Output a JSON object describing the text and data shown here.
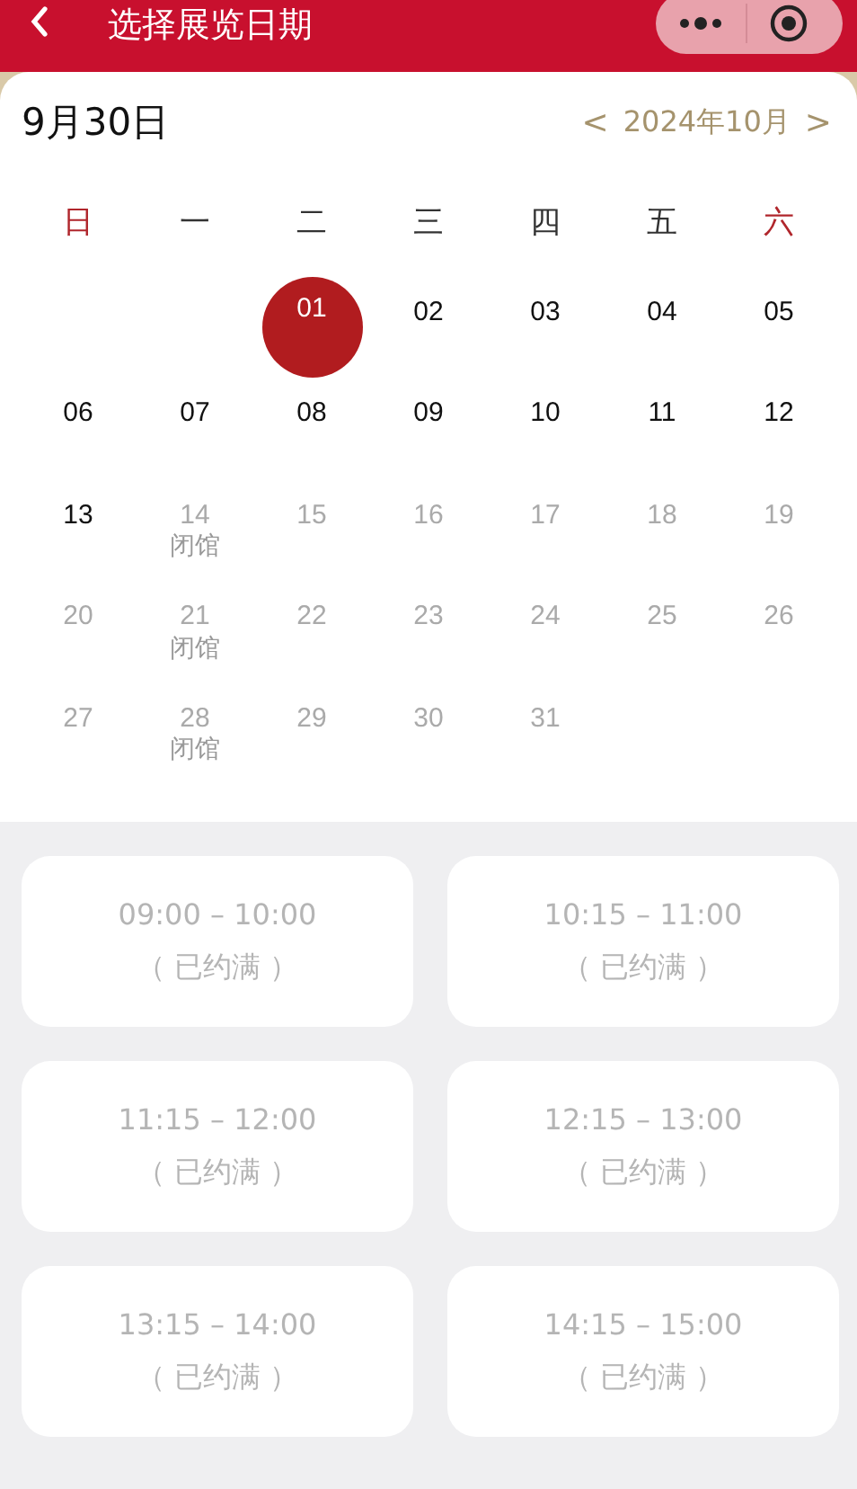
{
  "header": {
    "title": "选择展览日期"
  },
  "calendar": {
    "selected_date": "9月30日",
    "prev": "<",
    "month": "2024年10月",
    "next": ">",
    "weekdays": [
      {
        "label": "日",
        "weekend": true
      },
      {
        "label": "一",
        "weekend": false
      },
      {
        "label": "二",
        "weekend": false
      },
      {
        "label": "三",
        "weekend": false
      },
      {
        "label": "四",
        "weekend": false
      },
      {
        "label": "五",
        "weekend": false
      },
      {
        "label": "六",
        "weekend": true
      }
    ],
    "days": [
      {
        "kind": "blank"
      },
      {
        "kind": "blank"
      },
      {
        "kind": "day",
        "day": "01",
        "selected": true,
        "available": true
      },
      {
        "kind": "day",
        "day": "02",
        "selected": false,
        "available": true
      },
      {
        "kind": "day",
        "day": "03",
        "selected": false,
        "available": true
      },
      {
        "kind": "day",
        "day": "04",
        "selected": false,
        "available": true
      },
      {
        "kind": "day",
        "day": "05",
        "selected": false,
        "available": true
      },
      {
        "kind": "day",
        "day": "06",
        "selected": false,
        "available": true
      },
      {
        "kind": "day",
        "day": "07",
        "selected": false,
        "available": true
      },
      {
        "kind": "day",
        "day": "08",
        "selected": false,
        "available": true
      },
      {
        "kind": "day",
        "day": "09",
        "selected": false,
        "available": true
      },
      {
        "kind": "day",
        "day": "10",
        "selected": false,
        "available": true
      },
      {
        "kind": "day",
        "day": "11",
        "selected": false,
        "available": true
      },
      {
        "kind": "day",
        "day": "12",
        "selected": false,
        "available": true
      },
      {
        "kind": "day",
        "day": "13",
        "selected": false,
        "available": true
      },
      {
        "kind": "day",
        "day": "14",
        "selected": false,
        "available": false,
        "note": "闭馆"
      },
      {
        "kind": "day",
        "day": "15",
        "selected": false,
        "available": false
      },
      {
        "kind": "day",
        "day": "16",
        "selected": false,
        "available": false
      },
      {
        "kind": "day",
        "day": "17",
        "selected": false,
        "available": false
      },
      {
        "kind": "day",
        "day": "18",
        "selected": false,
        "available": false
      },
      {
        "kind": "day",
        "day": "19",
        "selected": false,
        "available": false
      },
      {
        "kind": "day",
        "day": "20",
        "selected": false,
        "available": false
      },
      {
        "kind": "day",
        "day": "21",
        "selected": false,
        "available": false,
        "note": "闭馆"
      },
      {
        "kind": "day",
        "day": "22",
        "selected": false,
        "available": false
      },
      {
        "kind": "day",
        "day": "23",
        "selected": false,
        "available": false
      },
      {
        "kind": "day",
        "day": "24",
        "selected": false,
        "available": false
      },
      {
        "kind": "day",
        "day": "25",
        "selected": false,
        "available": false
      },
      {
        "kind": "day",
        "day": "26",
        "selected": false,
        "available": false
      },
      {
        "kind": "day",
        "day": "27",
        "selected": false,
        "available": false
      },
      {
        "kind": "day",
        "day": "28",
        "selected": false,
        "available": false,
        "note": "闭馆"
      },
      {
        "kind": "day",
        "day": "29",
        "selected": false,
        "available": false
      },
      {
        "kind": "day",
        "day": "30",
        "selected": false,
        "available": false
      },
      {
        "kind": "day",
        "day": "31",
        "selected": false,
        "available": false
      }
    ]
  },
  "time_slots": [
    {
      "time": "09:00 – 10:00",
      "status": "（ 已约满 ）",
      "disabled": true
    },
    {
      "time": "10:15 – 11:00",
      "status": "（ 已约满 ）",
      "disabled": true
    },
    {
      "time": "11:15 – 12:00",
      "status": "（ 已约满 ）",
      "disabled": true
    },
    {
      "time": "12:15 – 13:00",
      "status": "（ 已约满 ）",
      "disabled": true
    },
    {
      "time": "13:15 – 14:00",
      "status": "（ 已约满 ）",
      "disabled": true
    },
    {
      "time": "14:15 – 15:00",
      "status": "（ 已约满 ）",
      "disabled": true
    }
  ]
}
